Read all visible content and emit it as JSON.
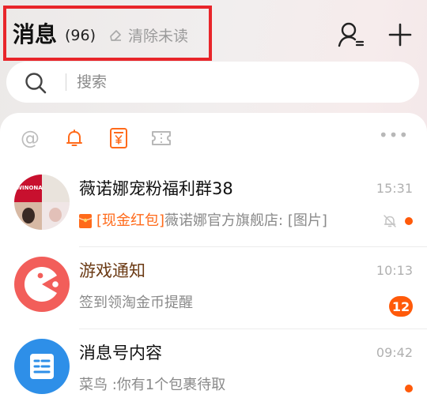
{
  "header": {
    "title": "消息",
    "count": "(96)",
    "clear_unread": "清除未读"
  },
  "search": {
    "placeholder": "搜索"
  },
  "filters": {
    "at": "@",
    "more": "•••"
  },
  "conversations": [
    {
      "name": "薇诺娜宠粉福利群38",
      "tag": "[现金红包]",
      "preview": " 薇诺娜官方旗舰店: [图片]",
      "time": "15:31",
      "avatar_text": "WINONA",
      "muted": true,
      "unread_dot": true
    },
    {
      "name": "游戏通知",
      "preview": "签到领淘金币提醒",
      "time": "10:13",
      "badge": "12"
    },
    {
      "name": "消息号内容",
      "preview": "菜鸟 :你有1个包裹待取",
      "time": "09:42",
      "unread_dot": true
    }
  ],
  "colors": {
    "accent": "#ff5a0a",
    "highlight_box": "#e8252a",
    "game_avatar": "#f25e5a",
    "msg_avatar": "#2e8fe8"
  }
}
